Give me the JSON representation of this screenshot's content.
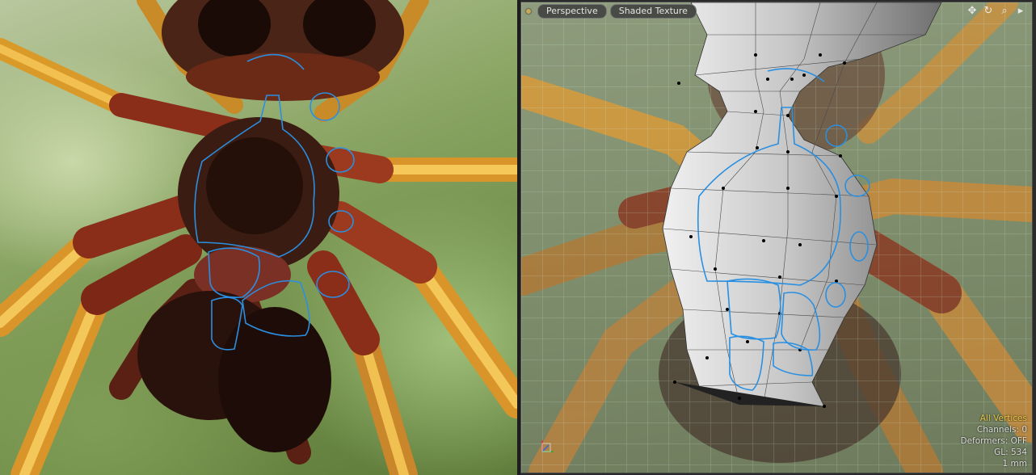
{
  "viewport": {
    "view_mode": "Perspective",
    "shading_mode": "Shaded Texture",
    "icons": [
      "move-view-icon",
      "rotate-view-icon",
      "zoom-view-icon",
      "viewport-menu-arrow-icon"
    ],
    "stats": {
      "selection_mode": "All Vertices",
      "channels": "Channels: 0",
      "deformers": "Deformers: OFF",
      "gl": "GL: 534",
      "grid_unit": "1 mm"
    }
  },
  "colors": {
    "stroke_accent": "#2a8fe0",
    "stats_accent": "#e8c74a",
    "leg_orange": "#e9a52a",
    "body_dark": "#3a1c12"
  }
}
